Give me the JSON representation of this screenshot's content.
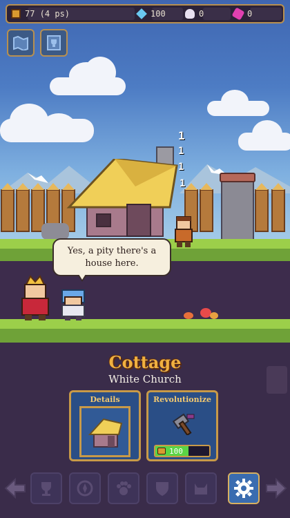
{
  "resources": {
    "gold": "77 (4 ps)",
    "gems": "100",
    "skulls": "0",
    "crystals": "0"
  },
  "dialog": {
    "line1": "Yes, a pity there's a",
    "line2": "house here."
  },
  "building": {
    "name": "Cottage",
    "subtitle": "White Church"
  },
  "cards": {
    "details_label": "Details",
    "revolutionize_label": "Revolutionize",
    "revolutionize_cost": "100",
    "revolutionize_progress": 0.62
  },
  "damage_numbers": [
    "1",
    "1",
    "1",
    "1"
  ],
  "nav": {
    "items": [
      "trophy-icon",
      "compass-icon",
      "paw-icon",
      "shield-icon",
      "cat-icon",
      "gear-icon"
    ],
    "active": "gear-icon"
  },
  "colors": {
    "gold_text": "#f0b040",
    "progress": "#5bd445",
    "frame": "#c89a48"
  }
}
